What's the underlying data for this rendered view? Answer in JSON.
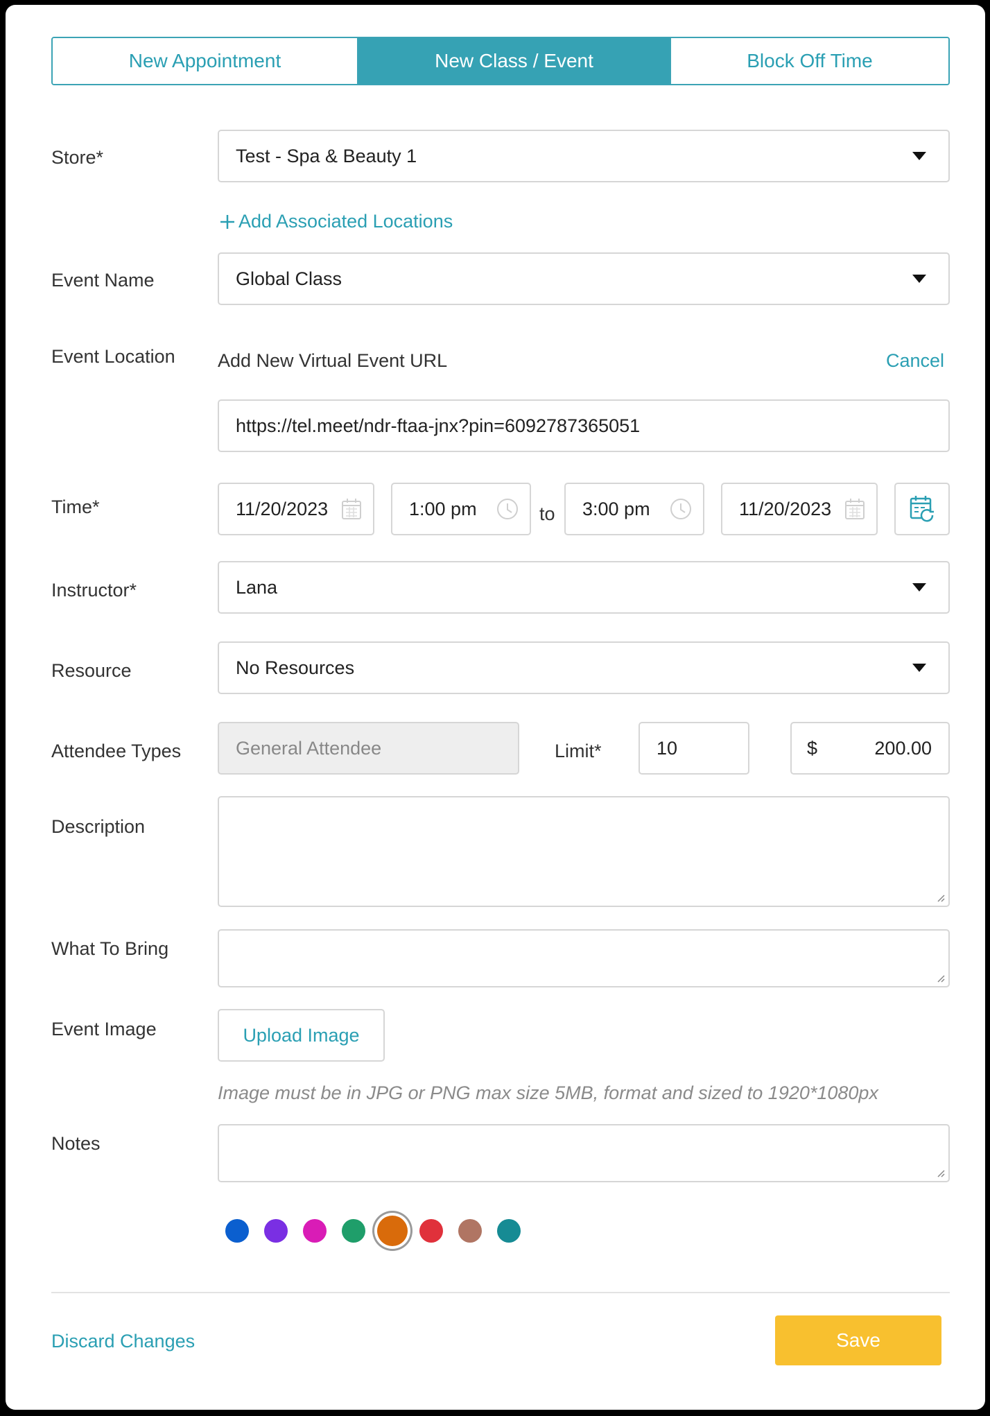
{
  "tabs": [
    {
      "label": "New Appointment",
      "active": false
    },
    {
      "label": "New Class / Event",
      "active": true
    },
    {
      "label": "Block Off Time",
      "active": false
    }
  ],
  "store": {
    "label": "Store*",
    "value": "Test - Spa & Beauty 1"
  },
  "add_locations": {
    "icon": "plus-icon",
    "label": "Add Associated Locations"
  },
  "event_name": {
    "label": "Event Name",
    "value": "Global Class"
  },
  "event_location": {
    "label": "Event Location",
    "sublabel": "Add New Virtual Event URL",
    "cancel": "Cancel",
    "url": "https://tel.meet/ndr-ftaa-jnx?pin=6092787365051"
  },
  "time": {
    "label": "Time*",
    "start_date": "11/20/2023",
    "start_time": "1:00 pm",
    "to": "to",
    "end_time": "3:00 pm",
    "end_date": "11/20/2023"
  },
  "instructor": {
    "label": "Instructor*",
    "value": "Lana"
  },
  "resource": {
    "label": "Resource",
    "value": "No Resources"
  },
  "attendee": {
    "label": "Attendee Types",
    "type": "General Attendee",
    "limit_label": "Limit*",
    "limit": "10",
    "currency": "$",
    "price": "200.00"
  },
  "description": {
    "label": "Description",
    "value": ""
  },
  "what_to_bring": {
    "label": "What To Bring",
    "value": ""
  },
  "event_image": {
    "label": "Event Image",
    "button": "Upload Image",
    "hint": "Image must be in JPG or PNG max size 5MB, format and sized to 1920*1080px"
  },
  "notes": {
    "label": "Notes",
    "value": ""
  },
  "colors": [
    "#0b5fcf",
    "#7a2fe3",
    "#d91cb6",
    "#1f9e6a",
    "#d96b0b",
    "#e0313b",
    "#b07563",
    "#168b94"
  ],
  "selected_color": "#d96b0b",
  "footer": {
    "discard": "Discard Changes",
    "save": "Save"
  },
  "theme": {
    "accent": "#36a2b4",
    "save": "#f8c02f"
  }
}
